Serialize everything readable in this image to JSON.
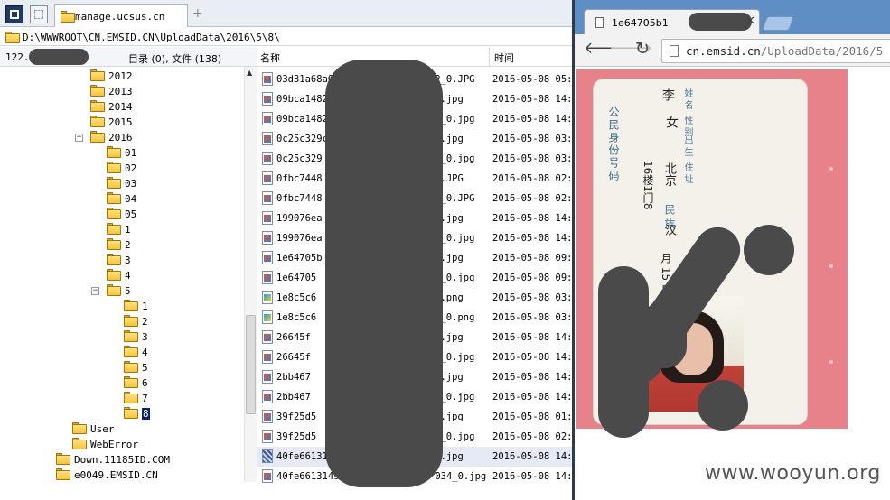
{
  "file_manager": {
    "tab_title": "manage.ucsus.cn",
    "address_path": "D:\\WWWROOT\\CN.EMSID.CN\\UploadData\\2016\\5\\8\\",
    "host_prefix": "122.",
    "folder_count_text": "目录 (0), 文件 (138)",
    "columns": {
      "name": "名称",
      "time": "时间"
    },
    "tree": [
      {
        "label": "2012",
        "depth": 1
      },
      {
        "label": "2013",
        "depth": 1
      },
      {
        "label": "2014",
        "depth": 1
      },
      {
        "label": "2015",
        "depth": 1
      },
      {
        "label": "2016",
        "depth": 1,
        "expanded": true
      },
      {
        "label": "01",
        "depth": 2
      },
      {
        "label": "02",
        "depth": 2
      },
      {
        "label": "03",
        "depth": 2
      },
      {
        "label": "04",
        "depth": 2
      },
      {
        "label": "05",
        "depth": 2
      },
      {
        "label": "1",
        "depth": 2
      },
      {
        "label": "2",
        "depth": 2
      },
      {
        "label": "3",
        "depth": 2
      },
      {
        "label": "4",
        "depth": 2
      },
      {
        "label": "5",
        "depth": 2,
        "expanded": true
      },
      {
        "label": "1",
        "depth": 3
      },
      {
        "label": "2",
        "depth": 3
      },
      {
        "label": "3",
        "depth": 3
      },
      {
        "label": "4",
        "depth": 3
      },
      {
        "label": "5",
        "depth": 3
      },
      {
        "label": "6",
        "depth": 3
      },
      {
        "label": "7",
        "depth": 3
      },
      {
        "label": "8",
        "depth": 3,
        "selected": true
      },
      {
        "label": "User",
        "depth": 0
      },
      {
        "label": "WebError",
        "depth": 0
      },
      {
        "label": "Down.11185ID.COM",
        "depth": -1
      },
      {
        "label": "e0049.EMSID.CN",
        "depth": -1
      }
    ],
    "files": [
      {
        "name": "03d31a68a0",
        "tail": "2_0.JPG",
        "time": "2016-05-08 05:0",
        "type": "jpg"
      },
      {
        "name": "09bca1482",
        "tail": "2.jpg",
        "time": "2016-05-08 14:4",
        "type": "jpg"
      },
      {
        "name": "09bca1482",
        "tail": "2_0.jpg",
        "time": "2016-05-08 14:4",
        "type": "jpg"
      },
      {
        "name": "0c25c329c",
        "tail": "4.jpg",
        "time": "2016-05-08 03:1",
        "type": "jpg"
      },
      {
        "name": "0c25c329",
        "tail": "4_0.jpg",
        "time": "2016-05-08 03:1",
        "type": "jpg"
      },
      {
        "name": "0fbc7448",
        "tail": "8.JPG",
        "time": "2016-05-08 02:3",
        "type": "jpg"
      },
      {
        "name": "0fbc7448",
        "tail": "8_0.JPG",
        "time": "2016-05-08 02:3",
        "type": "jpg"
      },
      {
        "name": "199076ea",
        "tail": "4.jpg",
        "time": "2016-05-08 14:2",
        "type": "jpg"
      },
      {
        "name": "199076ea",
        "tail": "4_0.jpg",
        "time": "2016-05-08 14:2",
        "type": "jpg"
      },
      {
        "name": "1e64705b",
        "tail": "9.jpg",
        "time": "2016-05-08 09:2",
        "type": "jpg"
      },
      {
        "name": "1e64705",
        "tail": "9_0.jpg",
        "time": "2016-05-08 09:2",
        "type": "jpg"
      },
      {
        "name": "1e8c5c6",
        "tail": "9.png",
        "time": "2016-05-08 03:2",
        "type": "png"
      },
      {
        "name": "1e8c5c6",
        "tail": "9_0.png",
        "time": "2016-05-08 03:2",
        "type": "png"
      },
      {
        "name": "26645f",
        "tail": "0.jpg",
        "time": "2016-05-08 14:2",
        "type": "jpg"
      },
      {
        "name": "26645f",
        "tail": "0_0.jpg",
        "time": "2016-05-08 14:2",
        "type": "jpg"
      },
      {
        "name": "2bb467",
        "tail": "7.jpg",
        "time": "2016-05-08 14:0",
        "type": "jpg"
      },
      {
        "name": "2bb467",
        "tail": "7_0.jpg",
        "time": "2016-05-08 14:0",
        "type": "jpg"
      },
      {
        "name": "39f25d5",
        "tail": "4.jpg",
        "time": "2016-05-08 01:5",
        "type": "jpg"
      },
      {
        "name": "39f25d5",
        "tail": "4_0.jpg",
        "time": "2016-05-08 02:0",
        "type": "jpg"
      },
      {
        "name": "40fe66131",
        "tail": "4.jpg",
        "time": "2016-05-08 14:4",
        "type": "sel",
        "selected": true
      },
      {
        "name": "40fe6613149e4d9",
        "tail": "034_0.jpg",
        "time": "2016-05-08 14:4",
        "type": "jpg"
      }
    ]
  },
  "browser": {
    "tab_title": "1e64705b1",
    "url_host": "cn.emsid.cn",
    "url_path": "/UploadData/2016/5",
    "id_card": {
      "header": "公民身份号码",
      "field_name": "姓 名",
      "field_gender": "性 别",
      "field_birth": "出 生",
      "field_address": "住 址",
      "name_value": "李",
      "gender_value": "女",
      "address_value": "北京",
      "address_value2": "16楼1门8",
      "nation_label": "民 族",
      "nation_value": "汉",
      "day_value": "月 15 日",
      "misc_value": "号",
      "id_tail": "8"
    }
  },
  "watermark": "www.wooyun.org"
}
